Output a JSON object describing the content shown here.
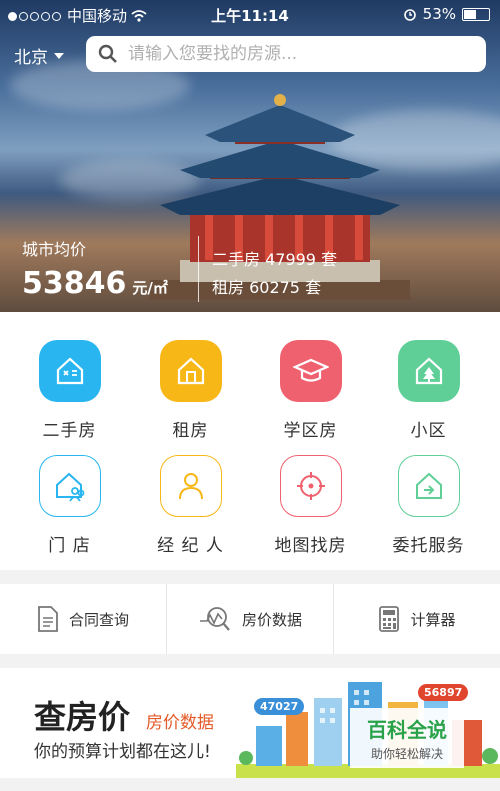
{
  "status_bar": {
    "carrier": "中国移动",
    "time": "上午11:14",
    "battery": "53%"
  },
  "header": {
    "city": "北京",
    "search_placeholder": "请输入您要找的房源..."
  },
  "hero": {
    "avg_label": "城市均价",
    "avg_price": "53846",
    "avg_unit": "元/㎡",
    "second_hand": "二手房 47999 套",
    "rental": "租房 60275 套"
  },
  "grid": {
    "items": [
      {
        "label": "二手房",
        "icon": "house-shuffle-icon",
        "color": "#29b6f0"
      },
      {
        "label": "租房",
        "icon": "house-door-icon",
        "color": "#f7b717"
      },
      {
        "label": "学区房",
        "icon": "graduation-cap-icon",
        "color": "#f0616f"
      },
      {
        "label": "小区",
        "icon": "house-tree-icon",
        "color": "#5fcf97"
      },
      {
        "label": "门  店",
        "icon": "store-people-icon",
        "color": "#29b6f0"
      },
      {
        "label": "经 纪 人",
        "icon": "agent-person-icon",
        "color": "#f7b717"
      },
      {
        "label": "地图找房",
        "icon": "map-target-icon",
        "color": "#f0616f"
      },
      {
        "label": "委托服务",
        "icon": "house-arrow-icon",
        "color": "#5fcf97"
      }
    ]
  },
  "tools": [
    {
      "label": "合同查询",
      "icon": "document-icon"
    },
    {
      "label": "房价数据",
      "icon": "price-chart-search-icon"
    },
    {
      "label": "计算器",
      "icon": "calculator-icon"
    }
  ],
  "banner": {
    "title": "查房价",
    "subtitle": "房价数据",
    "tagline": "你的预算计划都在这儿!",
    "bubble_left": "47027",
    "bubble_right": "56897",
    "watermark_title": "百科全说",
    "watermark_sub": "助你轻松解决"
  }
}
